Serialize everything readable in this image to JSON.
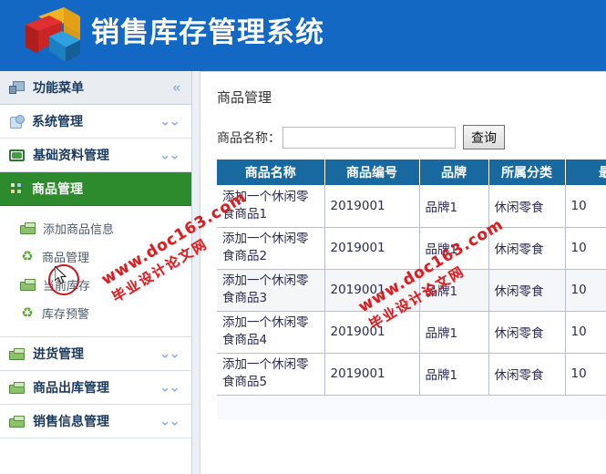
{
  "header": {
    "title": "销售库存管理系统",
    "logo_name": "cube-logo",
    "bg_color": "#1368c4"
  },
  "sidebar": {
    "groups": [
      {
        "label": "功能菜单",
        "icon": "monitor-icon",
        "chevron": "«",
        "state": "header"
      },
      {
        "label": "系统管理",
        "icon": "cylinder-icon",
        "chevron": "⌄⌄",
        "state": "collapsed"
      },
      {
        "label": "基础资料管理",
        "icon": "green-bar-icon",
        "chevron": "⌄⌄",
        "state": "collapsed"
      },
      {
        "label": "商品管理",
        "icon": "green-grid-icon",
        "chevron": "",
        "state": "active"
      }
    ],
    "sub_items": [
      {
        "label": "添加商品信息",
        "icon": "green-box-icon"
      },
      {
        "label": "商品管理",
        "icon": "recycle-icon"
      },
      {
        "label": "当前库存",
        "icon": "green-box-icon"
      },
      {
        "label": "库存预警",
        "icon": "recycle-icon"
      }
    ],
    "groups_bottom": [
      {
        "label": "进货管理",
        "icon": "green-box-icon",
        "chevron": "⌄⌄"
      },
      {
        "label": "商品出库管理",
        "icon": "green-box-icon",
        "chevron": "⌄⌄"
      },
      {
        "label": "销售信息管理",
        "icon": "green-box-icon",
        "chevron": "⌄⌄"
      }
    ],
    "active_color": "#2d8a2d"
  },
  "main": {
    "page_title": "商品管理",
    "search": {
      "label": "商品名称：",
      "value": "",
      "placeholder": "",
      "button_label": "查询"
    },
    "table": {
      "header_color": "#18699f",
      "columns": [
        "商品名称",
        "商品编号",
        "品牌",
        "所属分类",
        "最"
      ],
      "rows": [
        {
          "name": "添加一个休闲零食商品1",
          "code": "2019001",
          "brand": "品牌1",
          "category": "休闲零食",
          "extra": "10",
          "highlighted": false
        },
        {
          "name": "添加一个休闲零食商品2",
          "code": "2019001",
          "brand": "品牌1",
          "category": "休闲零食",
          "extra": "10",
          "highlighted": false
        },
        {
          "name": "添加一个休闲零食商品3",
          "code": "2019001",
          "brand": "品牌1",
          "category": "休闲零食",
          "extra": "10",
          "highlighted": true
        },
        {
          "name": "添加一个休闲零食商品4",
          "code": "2019001",
          "brand": "品牌1",
          "category": "休闲零食",
          "extra": "10",
          "highlighted": false
        },
        {
          "name": "添加一个休闲零食商品5",
          "code": "2019001",
          "brand": "品牌1",
          "category": "休闲零食",
          "extra": "10",
          "highlighted": false
        }
      ]
    }
  },
  "watermark": {
    "line1": "www.doc163.com",
    "line2": "毕业设计论文网",
    "color": "#d81e22"
  }
}
